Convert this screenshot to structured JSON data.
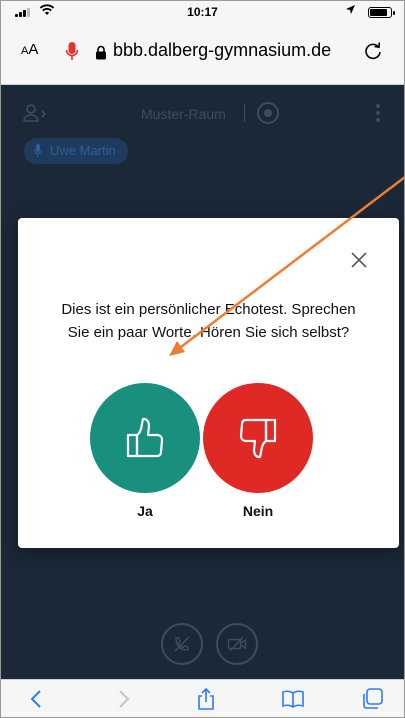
{
  "status_bar": {
    "time": "10:17",
    "battery_level": 0.85
  },
  "browser": {
    "text_size_label_small": "A",
    "text_size_label_large": "A",
    "url": "bbb.dalberg-gymnasium.de"
  },
  "meeting": {
    "room_name": "Muster-Raum",
    "talker_name": "Uwe Martin"
  },
  "echo_test": {
    "prompt_line1": "Dies ist ein persönlicher Echotest. Sprechen",
    "prompt_line2": "Sie ein paar Worte. Hören Sie sich selbst?",
    "yes_label": "Ja",
    "no_label": "Nein"
  },
  "colors": {
    "yes": "#198f7e",
    "no": "#e02925",
    "annotation_arrow": "#ed7d31",
    "app_background": "#1b2838"
  },
  "icons": {
    "status": [
      "cellular-signal-icon",
      "wifi-icon",
      "location-arrow-icon",
      "battery-icon"
    ],
    "browser": [
      "text-size-icon",
      "microphone-recording-icon",
      "lock-icon",
      "reload-icon"
    ],
    "toolbar": [
      "back-icon",
      "forward-icon",
      "share-icon",
      "bookmarks-icon",
      "tabs-icon"
    ],
    "meeting": [
      "user-list-icon",
      "record-icon",
      "options-icon",
      "mute-audio-icon",
      "video-off-icon",
      "thumbs-up-icon",
      "thumbs-down-icon",
      "close-icon"
    ]
  }
}
